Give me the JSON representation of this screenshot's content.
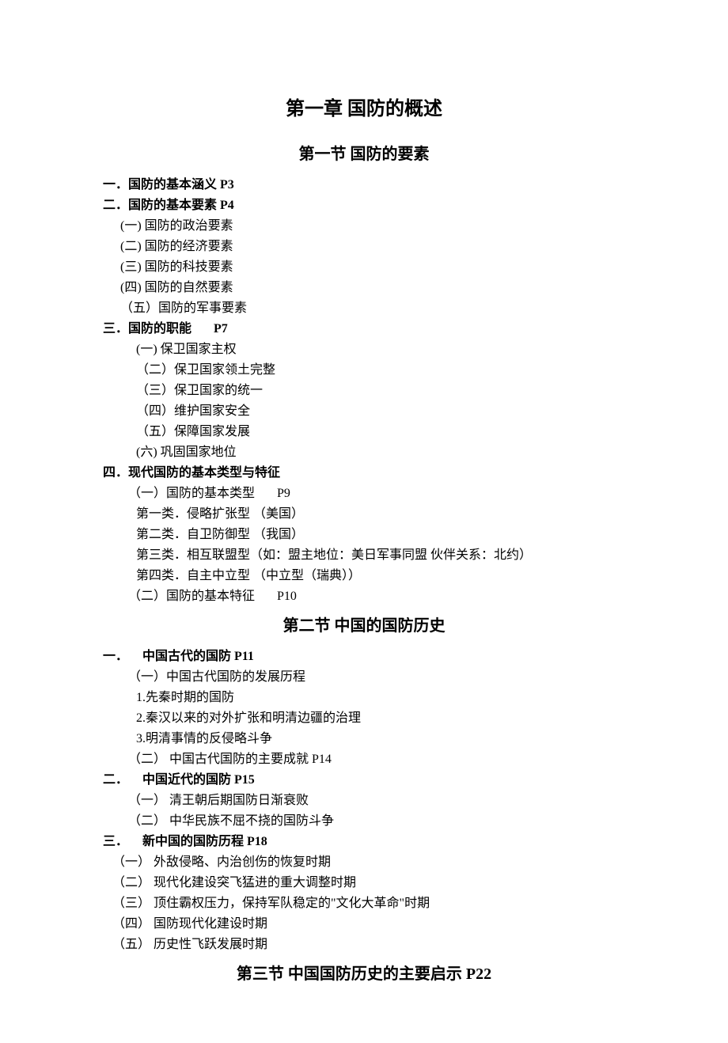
{
  "chapter": {
    "title": "第一章  国防的概述"
  },
  "section1": {
    "title": "第一节  国防的要素",
    "h1": "一．国防的基本涵义  P3",
    "h2": "二．国防的基本要素  P4",
    "h2_items": {
      "a": "(一) 国防的政治要素",
      "b": "(二) 国防的经济要素",
      "c": "(三) 国防的科技要素",
      "d": "(四) 国防的自然要素",
      "e": "（五）国防的军事要素"
    },
    "h3_prefix": "三．国防的职能",
    "h3_page": "P7",
    "h3_items": {
      "a": "(一) 保卫国家主权",
      "b": "（二）保卫国家领土完整",
      "c": "（三）保卫国家的统一",
      "d": "（四）维护国家安全",
      "e": "（五）保障国家发展",
      "f": "(六) 巩固国家地位"
    },
    "h4": "四．现代国防的基本类型与特征",
    "h4_a_prefix": "（一）国防的基本类型",
    "h4_a_page": "P9",
    "h4_a_items": {
      "a": "第一类．侵略扩张型 （美国）",
      "b": "第二类．自卫防御型 （我国）",
      "c": "第三类．相互联盟型（如：盟主地位：美日军事同盟    伙伴关系：北约）",
      "d": "第四类．自主中立型 （中立型（瑞典））"
    },
    "h4_b_prefix": "（二）国防的基本特征",
    "h4_b_page": "P10"
  },
  "section2": {
    "title": "第二节  中国的国防历史",
    "h1_prefix": "一．",
    "h1_text": "中国古代的国防 P11",
    "h1_a": "（一）中国古代国防的发展历程",
    "h1_a_items": {
      "a": "1.先秦时期的国防",
      "b": "2.秦汉以来的对外扩张和明清边疆的治理",
      "c": "3.明清事情的反侵略斗争"
    },
    "h1_b": "（二） 中国古代国防的主要成就  P14",
    "h2_prefix": "二．",
    "h2_text": "中国近代的国防  P15",
    "h2_items": {
      "a": "（一） 清王朝后期国防日渐衰败",
      "b": "（二） 中华民族不屈不挠的国防斗争"
    },
    "h3_prefix": "三．",
    "h3_text": "新中国的国防历程 P18",
    "h3_items": {
      "a": "（一） 外敌侵略、内治创伤的恢复时期",
      "b": "（二） 现代化建设突飞猛进的重大调整时期",
      "c": "（三） 顶住霸权压力，保持军队稳定的\"文化大革命\"时期",
      "d": "（四） 国防现代化建设时期",
      "e": "（五） 历史性飞跃发展时期"
    }
  },
  "section3": {
    "title": "第三节  中国国防历史的主要启示  P22"
  }
}
